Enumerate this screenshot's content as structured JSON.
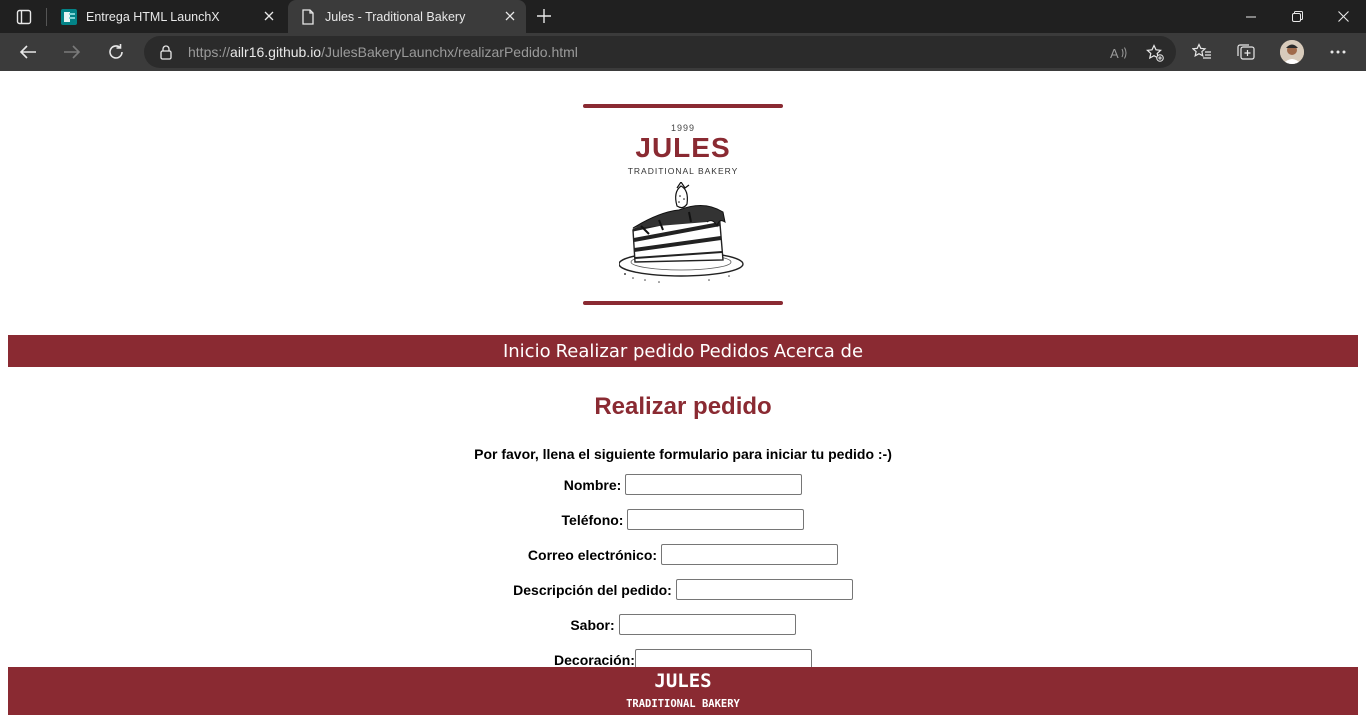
{
  "browser": {
    "tabs": [
      {
        "title": "Entrega HTML LaunchX",
        "icon": "forms-icon",
        "active": false
      },
      {
        "title": "Jules - Traditional Bakery",
        "icon": "page-icon",
        "active": true
      }
    ],
    "url_prefix": "https://",
    "url_host": "ailr16.github.io",
    "url_path": "/JulesBakeryLaunchx/realizarPedido.html"
  },
  "logo": {
    "year": "1999",
    "name": "JULES",
    "tagline": "TRADITIONAL BAKERY"
  },
  "nav": {
    "items": [
      "Inicio",
      "Realizar pedido",
      "Pedidos",
      "Acerca de"
    ]
  },
  "main": {
    "title": "Realizar pedido",
    "intro": "Por favor, llena el siguiente formulario para iniciar tu pedido :-)",
    "fields": [
      {
        "label": "Nombre:",
        "value": ""
      },
      {
        "label": "Teléfono:",
        "value": ""
      },
      {
        "label": "Correo electrónico:",
        "value": ""
      },
      {
        "label": "Descripción del pedido:",
        "value": ""
      },
      {
        "label": "Sabor:",
        "value": ""
      },
      {
        "label": "Decoración:",
        "value": ""
      }
    ]
  },
  "footer": {
    "name": "JULES",
    "tagline": "TRADITIONAL BAKERY"
  },
  "colors": {
    "brand": "#8a2a32",
    "chrome_dark": "#202020",
    "chrome_toolbar": "#3b3b3b"
  }
}
